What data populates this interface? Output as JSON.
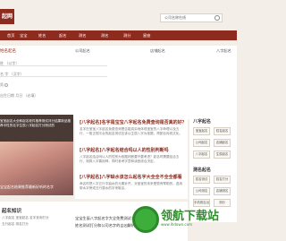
{
  "brand": {
    "logo_text": "起网"
  },
  "search": {
    "placeholder": "公司名称在线"
  },
  "nav": {
    "items": [
      "首页",
      "宝宝",
      "姓名",
      "起名",
      "测名",
      "测名",
      "测分",
      "星座"
    ]
  },
  "form": {
    "title": "姓名起名",
    "col2": "公司起名",
    "col3": "店铺起名",
    "col4": "八字起名",
    "line1": "姓 （以字）",
    "line2": "名 字 （汉字）",
    "line3": "男",
    "line4": "出生日期 月日 （必填）"
  },
  "hero": {
    "text": "宝宝起名大全和起名软件推荐测试评分结果新品推荐中性的名字生辰八字起名打分测试的",
    "caption": "宝宝起名结果推荐最新好听的名字"
  },
  "articles": [
    {
      "title": "[八字起名]名字是宝宝八字起名免费查询是否真的好？",
      "body": "名字在宝宝八字起名免费查询是否能真实地体现宝宝的八字命理以及五行，一般正规平台的起名测试应该以生辰八字为依据，再配合传统文化。"
    },
    {
      "title": "[八字起名]八字起名结合吗以人的性别判断吗",
      "body": "八字起名结合吗以人的性别为依据判断要不要考虑？起名时需要结合五行，测算八字喜用神，同时参考字意和读音综合决定。"
    },
    {
      "title": "[八字起名]八字缺水该怎么起名字大全全不全全都看",
      "body": "命名时把八字五行中缺水的元素补齐，对宝宝的未来是很有帮助的，选用带水字旁或五行属水的字来取名。"
    }
  ],
  "side": {
    "head1": "八字起名",
    "buttons1": [
      "宝宝起名",
      "姓名起名",
      "公司起名",
      "店铺起名",
      "八字起名",
      "生辰起名"
    ],
    "head2": "测名起名",
    "buttons2": [
      "姓名测试",
      "姓名打分",
      "公司测名",
      "店铺测名",
      "手机测吉凶",
      "测分"
    ]
  },
  "bottom": {
    "title": "起名知识",
    "sub1": "八字起名 宝宝起名 名字查询打分",
    "sub2": "五行起名 测名打分",
    "art1": "宝宝生辰八字起名字大全免费测试名字打分",
    "art2": "姓名测试打分和公司名字的吉凶解析"
  },
  "watermark": {
    "text": "领航下载站",
    "sub": "www.lhdown.com"
  }
}
